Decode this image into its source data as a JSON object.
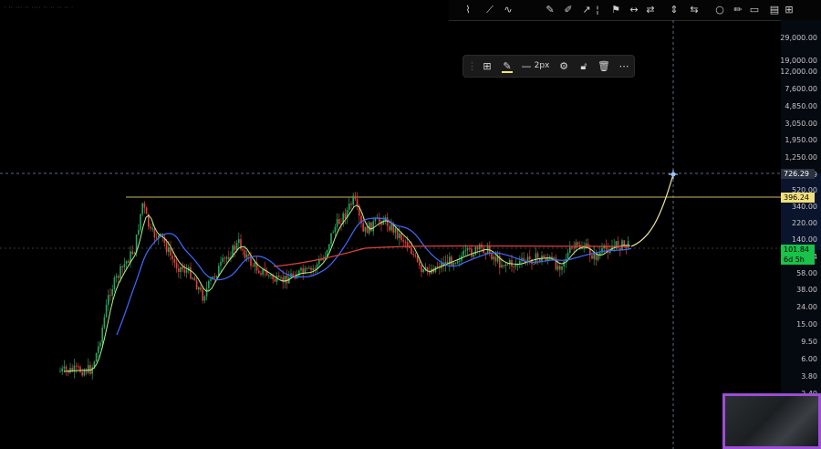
{
  "legend_text": "· ·· ··· ·· ···· ·· ·· ·· ·· ·",
  "toolbar": {
    "stroke_width_label": "2px",
    "icons": [
      "pattern-icon",
      "path-icon",
      "brush-icon",
      "highlighter-icon",
      "pen-icon",
      "arrow-icon",
      "marker-icon",
      "flag-icon",
      "ruler-icon",
      "forecast-icon",
      "price-range-icon",
      "date-range-icon",
      "bars-pattern-icon",
      "circle-icon",
      "pencil-icon",
      "text-icon",
      "note-icon"
    ]
  },
  "floating_toolbar": {
    "items": [
      "grip-icon",
      "template-icon",
      "line-color-icon",
      "line-style-icon",
      "settings-icon",
      "lock-icon",
      "delete-icon",
      "more-icon"
    ],
    "stroke_width_label": "2px",
    "line_color": "#f5e76b"
  },
  "price_axis": {
    "ticks": [
      "19,000.00",
      "29,000.00",
      "19,000.00",
      "12,000.00",
      "7,600.00",
      "4,850.00",
      "3,050.00",
      "1,950.00",
      "1,250.00",
      "726.29",
      "520.00",
      "340.00",
      "220.00",
      "140.00",
      "101.84",
      "58.00",
      "38.00",
      "24.00",
      "15.00",
      "9.50",
      "6.00",
      "3.80",
      "2.40"
    ],
    "crosshair_price": "726.29",
    "horizontal_line_price": "396.24",
    "last_price": "101.84",
    "countdown": "6d 5h"
  },
  "colors": {
    "background": "#000000",
    "bull_candle": "#26a65b",
    "bear_candle": "#e0413b",
    "ma_fast": "#b7f08a",
    "ma_mid": "#3d6bff",
    "ma_slow": "#e0413b",
    "forecast_curve": "#f3eda1",
    "horizontal_line": "#c9b96a",
    "crosshair": "#5a6b80",
    "last_price_tag": "#19c24a",
    "webcam_border": "#9b4ed6"
  }
}
